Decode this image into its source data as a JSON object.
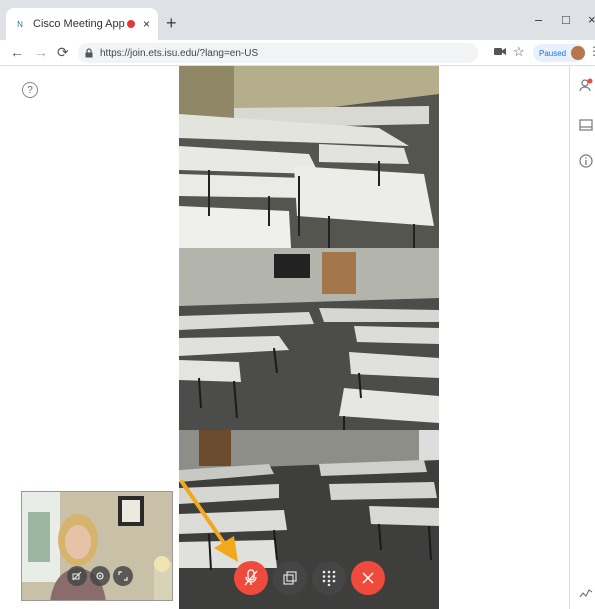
{
  "browser": {
    "tab_title": "Cisco Meeting App",
    "tab_favicon": "N",
    "tab_close": "×",
    "new_tab": "+",
    "url": "https://join.ets.isu.edu/?lang=en-US",
    "profile_status": "Paused",
    "window_minimize": "–",
    "window_maximize": "□",
    "window_close": "×"
  },
  "meeting": {
    "help_label": "?",
    "participants": [
      "Room camera 1",
      "Room camera 2",
      "Room camera 3"
    ],
    "controls": [
      {
        "name": "mute-microphone-button",
        "icon": "mic-off-icon",
        "color": "#ef4b3c"
      },
      {
        "name": "share-screen-button",
        "icon": "screen-share-icon",
        "color": "#464646"
      },
      {
        "name": "dialpad-button",
        "icon": "dialpad-icon",
        "color": "#464646"
      },
      {
        "name": "leave-call-button",
        "icon": "close-icon",
        "color": "#ef4b3c"
      }
    ],
    "selfview_controls": [
      "camera-off-icon",
      "settings-icon",
      "expand-icon"
    ]
  },
  "annotation": {
    "arrow_color": "#f2a81d"
  }
}
